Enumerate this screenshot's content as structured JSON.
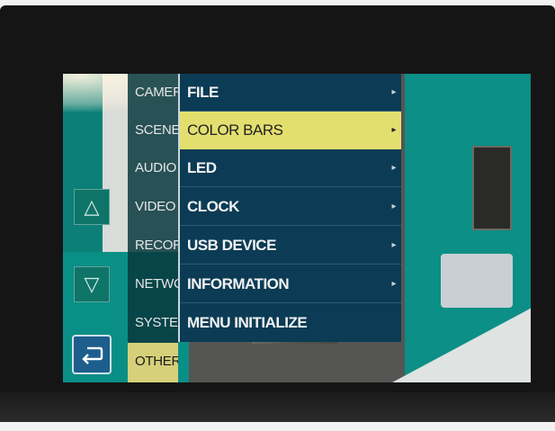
{
  "menu": {
    "categories": [
      {
        "label": "CAMERA",
        "selected": false
      },
      {
        "label": "SCENE",
        "selected": false
      },
      {
        "label": "AUDIO",
        "selected": false
      },
      {
        "label": "VIDEO",
        "selected": false
      },
      {
        "label": "RECORDING",
        "selected": false
      },
      {
        "label": "NETWORK",
        "selected": false
      },
      {
        "label": "SYSTEM",
        "selected": false
      },
      {
        "label": "OTHERS",
        "selected": true
      }
    ],
    "items": [
      {
        "label": "FILE",
        "arrow": "▸",
        "highlighted": false
      },
      {
        "label": "COLOR BARS",
        "arrow": "▸",
        "highlighted": true
      },
      {
        "label": "LED",
        "arrow": "▸",
        "highlighted": false
      },
      {
        "label": "CLOCK",
        "arrow": "▸",
        "highlighted": false
      },
      {
        "label": "USB DEVICE",
        "arrow": "▸",
        "highlighted": false
      },
      {
        "label": "INFORMATION",
        "arrow": "▸",
        "highlighted": false
      },
      {
        "label": "MENU INITIALIZE",
        "arrow": "",
        "highlighted": false
      }
    ]
  },
  "controls": {
    "up_glyph": "△",
    "down_glyph": "▽"
  },
  "icons": {
    "up": "triangle-up-icon",
    "down": "triangle-down-icon",
    "back": "return-arrow-icon"
  },
  "colors": {
    "highlight": "#e3df6f",
    "selected_category": "#d7d07a",
    "panel": "#0b3b55",
    "button_teal": "#0f7468",
    "back_button": "#1d5e8c"
  }
}
